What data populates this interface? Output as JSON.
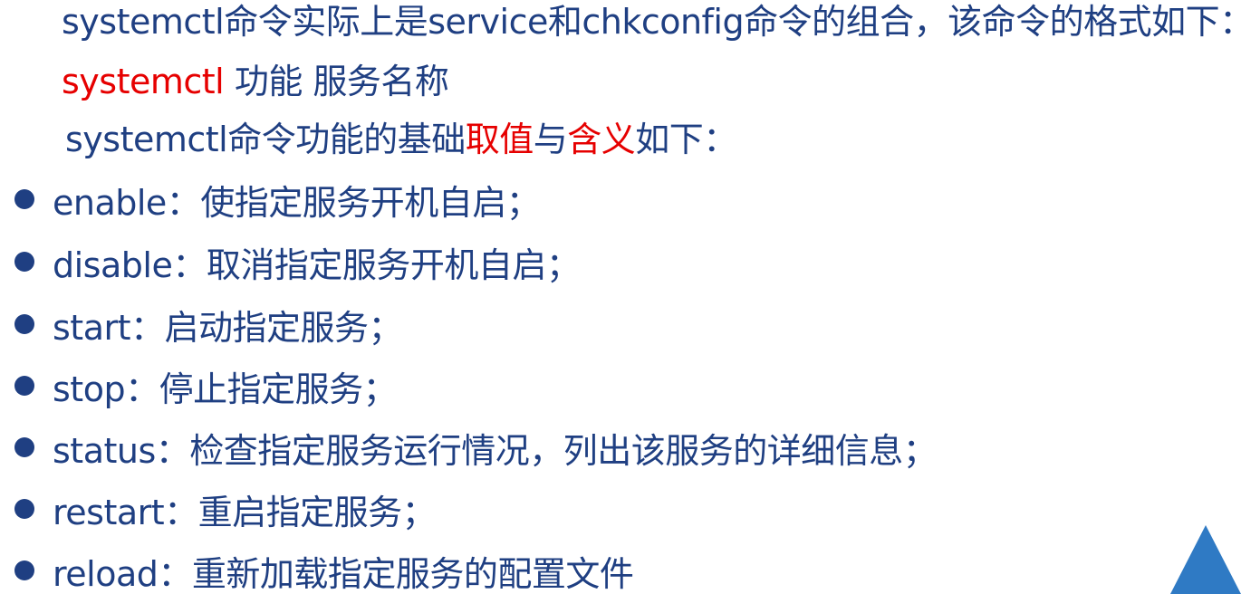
{
  "intro": {
    "line1": "systemctl命令实际上是service和chkconfig命令的组合，该命令的格式如下：",
    "format_command": "systemctl",
    "format_rest": " 功能 服务名称",
    "line3_part1": "systemctl命令功能的基础",
    "line3_red1": "取值",
    "line3_part2": "与",
    "line3_red2": "含义",
    "line3_part3": "如下："
  },
  "items": [
    {
      "text": "enable：使指定服务开机自启；"
    },
    {
      "text": "disable：取消指定服务开机自启；"
    },
    {
      "text": "start：启动指定服务；"
    },
    {
      "text": "stop：停止指定服务；"
    },
    {
      "text": "status：检查指定服务运行情况，列出该服务的详细信息；"
    },
    {
      "text": "restart：重启指定服务；"
    },
    {
      "text": "reload：重新加载指定服务的配置文件"
    }
  ],
  "colors": {
    "text": "#1f3f82",
    "highlight": "#e60000",
    "accent_triangle": "#2f7ac4"
  }
}
